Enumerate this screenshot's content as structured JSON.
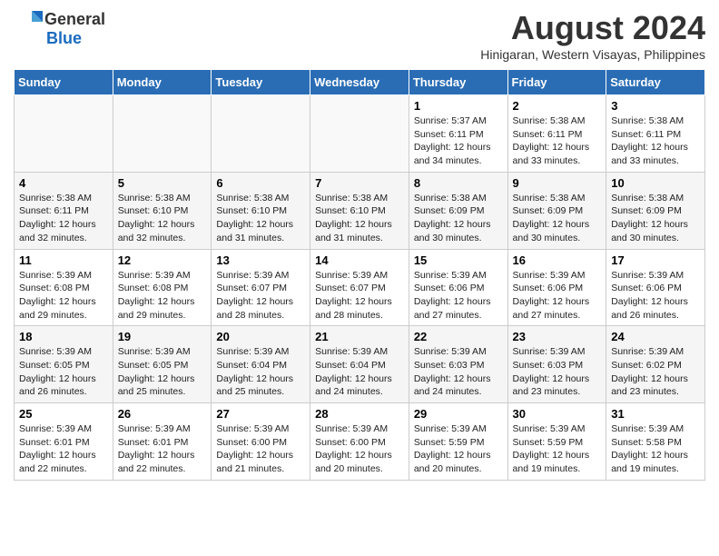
{
  "logo": {
    "general": "General",
    "blue": "Blue"
  },
  "title": "August 2024",
  "subtitle": "Hinigaran, Western Visayas, Philippines",
  "headers": [
    "Sunday",
    "Monday",
    "Tuesday",
    "Wednesday",
    "Thursday",
    "Friday",
    "Saturday"
  ],
  "weeks": [
    [
      {
        "day": "",
        "content": ""
      },
      {
        "day": "",
        "content": ""
      },
      {
        "day": "",
        "content": ""
      },
      {
        "day": "",
        "content": ""
      },
      {
        "day": "1",
        "content": "Sunrise: 5:37 AM\nSunset: 6:11 PM\nDaylight: 12 hours\nand 34 minutes."
      },
      {
        "day": "2",
        "content": "Sunrise: 5:38 AM\nSunset: 6:11 PM\nDaylight: 12 hours\nand 33 minutes."
      },
      {
        "day": "3",
        "content": "Sunrise: 5:38 AM\nSunset: 6:11 PM\nDaylight: 12 hours\nand 33 minutes."
      }
    ],
    [
      {
        "day": "4",
        "content": "Sunrise: 5:38 AM\nSunset: 6:11 PM\nDaylight: 12 hours\nand 32 minutes."
      },
      {
        "day": "5",
        "content": "Sunrise: 5:38 AM\nSunset: 6:10 PM\nDaylight: 12 hours\nand 32 minutes."
      },
      {
        "day": "6",
        "content": "Sunrise: 5:38 AM\nSunset: 6:10 PM\nDaylight: 12 hours\nand 31 minutes."
      },
      {
        "day": "7",
        "content": "Sunrise: 5:38 AM\nSunset: 6:10 PM\nDaylight: 12 hours\nand 31 minutes."
      },
      {
        "day": "8",
        "content": "Sunrise: 5:38 AM\nSunset: 6:09 PM\nDaylight: 12 hours\nand 30 minutes."
      },
      {
        "day": "9",
        "content": "Sunrise: 5:38 AM\nSunset: 6:09 PM\nDaylight: 12 hours\nand 30 minutes."
      },
      {
        "day": "10",
        "content": "Sunrise: 5:38 AM\nSunset: 6:09 PM\nDaylight: 12 hours\nand 30 minutes."
      }
    ],
    [
      {
        "day": "11",
        "content": "Sunrise: 5:39 AM\nSunset: 6:08 PM\nDaylight: 12 hours\nand 29 minutes."
      },
      {
        "day": "12",
        "content": "Sunrise: 5:39 AM\nSunset: 6:08 PM\nDaylight: 12 hours\nand 29 minutes."
      },
      {
        "day": "13",
        "content": "Sunrise: 5:39 AM\nSunset: 6:07 PM\nDaylight: 12 hours\nand 28 minutes."
      },
      {
        "day": "14",
        "content": "Sunrise: 5:39 AM\nSunset: 6:07 PM\nDaylight: 12 hours\nand 28 minutes."
      },
      {
        "day": "15",
        "content": "Sunrise: 5:39 AM\nSunset: 6:06 PM\nDaylight: 12 hours\nand 27 minutes."
      },
      {
        "day": "16",
        "content": "Sunrise: 5:39 AM\nSunset: 6:06 PM\nDaylight: 12 hours\nand 27 minutes."
      },
      {
        "day": "17",
        "content": "Sunrise: 5:39 AM\nSunset: 6:06 PM\nDaylight: 12 hours\nand 26 minutes."
      }
    ],
    [
      {
        "day": "18",
        "content": "Sunrise: 5:39 AM\nSunset: 6:05 PM\nDaylight: 12 hours\nand 26 minutes."
      },
      {
        "day": "19",
        "content": "Sunrise: 5:39 AM\nSunset: 6:05 PM\nDaylight: 12 hours\nand 25 minutes."
      },
      {
        "day": "20",
        "content": "Sunrise: 5:39 AM\nSunset: 6:04 PM\nDaylight: 12 hours\nand 25 minutes."
      },
      {
        "day": "21",
        "content": "Sunrise: 5:39 AM\nSunset: 6:04 PM\nDaylight: 12 hours\nand 24 minutes."
      },
      {
        "day": "22",
        "content": "Sunrise: 5:39 AM\nSunset: 6:03 PM\nDaylight: 12 hours\nand 24 minutes."
      },
      {
        "day": "23",
        "content": "Sunrise: 5:39 AM\nSunset: 6:03 PM\nDaylight: 12 hours\nand 23 minutes."
      },
      {
        "day": "24",
        "content": "Sunrise: 5:39 AM\nSunset: 6:02 PM\nDaylight: 12 hours\nand 23 minutes."
      }
    ],
    [
      {
        "day": "25",
        "content": "Sunrise: 5:39 AM\nSunset: 6:01 PM\nDaylight: 12 hours\nand 22 minutes."
      },
      {
        "day": "26",
        "content": "Sunrise: 5:39 AM\nSunset: 6:01 PM\nDaylight: 12 hours\nand 22 minutes."
      },
      {
        "day": "27",
        "content": "Sunrise: 5:39 AM\nSunset: 6:00 PM\nDaylight: 12 hours\nand 21 minutes."
      },
      {
        "day": "28",
        "content": "Sunrise: 5:39 AM\nSunset: 6:00 PM\nDaylight: 12 hours\nand 20 minutes."
      },
      {
        "day": "29",
        "content": "Sunrise: 5:39 AM\nSunset: 5:59 PM\nDaylight: 12 hours\nand 20 minutes."
      },
      {
        "day": "30",
        "content": "Sunrise: 5:39 AM\nSunset: 5:59 PM\nDaylight: 12 hours\nand 19 minutes."
      },
      {
        "day": "31",
        "content": "Sunrise: 5:39 AM\nSunset: 5:58 PM\nDaylight: 12 hours\nand 19 minutes."
      }
    ]
  ]
}
